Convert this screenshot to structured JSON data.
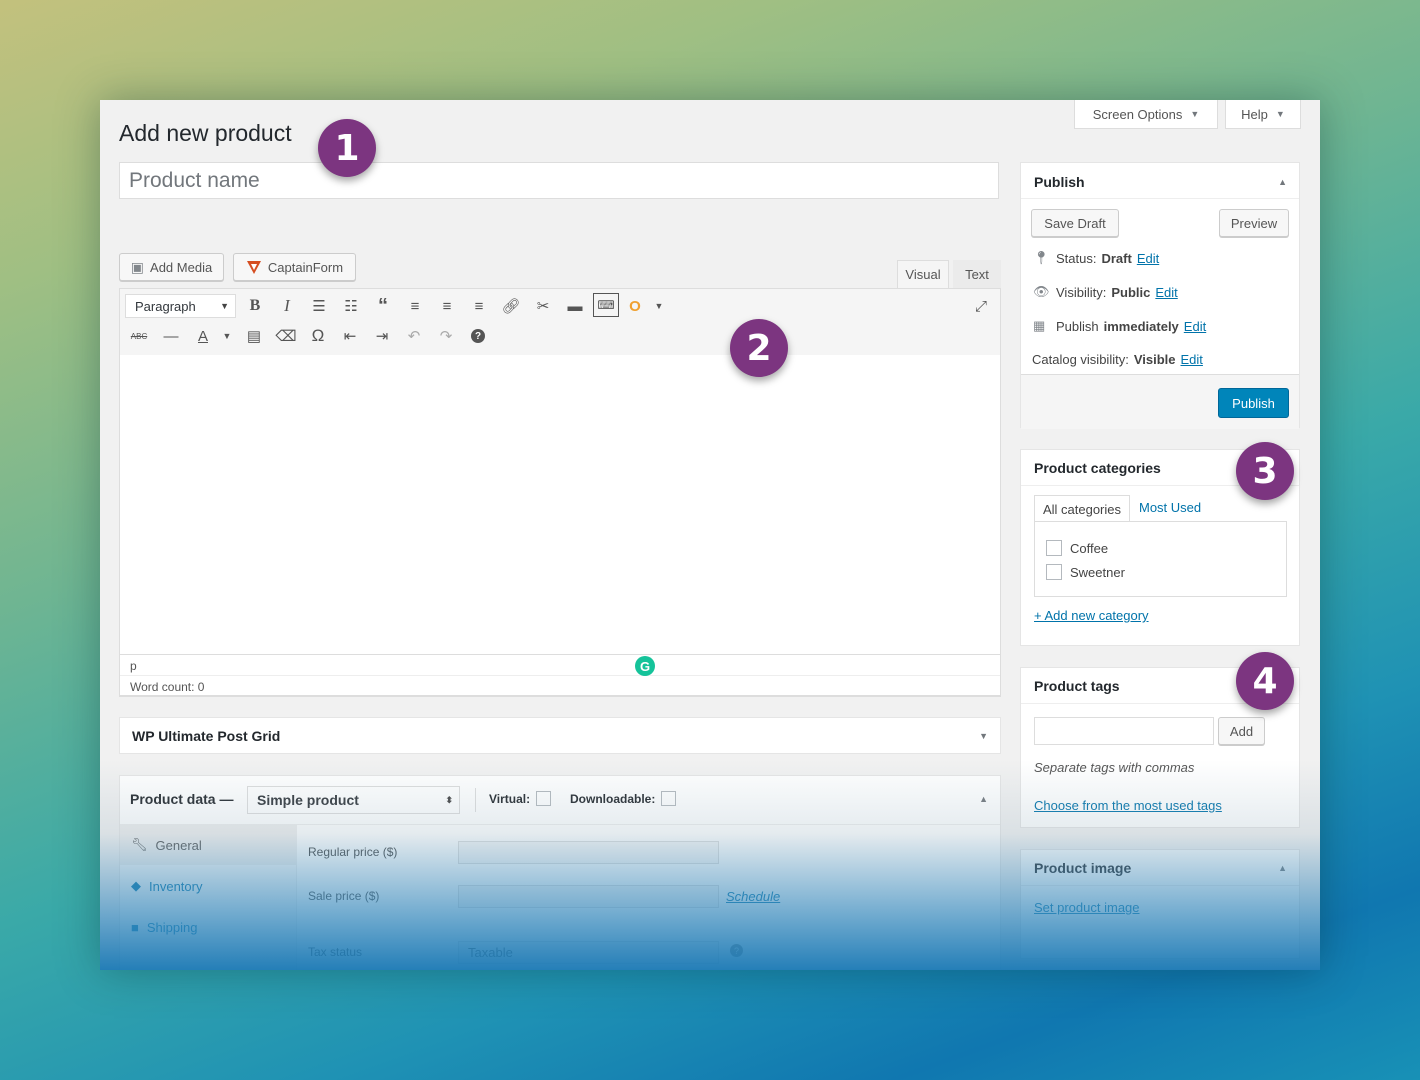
{
  "header": {
    "page_title": "Add new product",
    "screen_options_label": "Screen Options",
    "help_label": "Help",
    "product_name_placeholder": "Product name"
  },
  "editor": {
    "add_media_label": "Add Media",
    "captainform_label": "CaptainForm",
    "tab_visual": "Visual",
    "tab_text": "Text",
    "format_select": "Paragraph",
    "path_label": "p",
    "word_count": "Word count: 0"
  },
  "post_grid": {
    "title": "WP Ultimate Post Grid"
  },
  "product_data": {
    "title": "Product data —",
    "type_select": "Simple product",
    "virtual_label": "Virtual:",
    "downloadable_label": "Downloadable:",
    "tabs": [
      {
        "label": "General"
      },
      {
        "label": "Inventory"
      },
      {
        "label": "Shipping"
      }
    ],
    "regular_price_label": "Regular price ($)",
    "sale_price_label": "Sale price ($)",
    "schedule_link": "Schedule",
    "tax_status_label": "Tax status",
    "tax_status_value": "Taxable"
  },
  "publish": {
    "title": "Publish",
    "save_draft_label": "Save Draft",
    "preview_label": "Preview",
    "status_label": "Status:",
    "status_value": "Draft",
    "visibility_label": "Visibility:",
    "visibility_value": "Public",
    "publish_label": "Publish",
    "publish_value": "immediately",
    "catalog_label": "Catalog visibility:",
    "catalog_value": "Visible",
    "edit_link": "Edit",
    "publish_button": "Publish"
  },
  "categories": {
    "title": "Product categories",
    "tab_all": "All categories",
    "tab_most_used": "Most Used",
    "items": [
      {
        "label": "Coffee"
      },
      {
        "label": "Sweetner"
      }
    ],
    "add_new_link": "+ Add new category"
  },
  "tags": {
    "title": "Product tags",
    "add_button": "Add",
    "hint": "Separate tags with commas",
    "choose_link": "Choose from the most used tags"
  },
  "product_image": {
    "title": "Product image",
    "set_link": "Set product image"
  },
  "callouts": [
    "1",
    "2",
    "3",
    "4"
  ],
  "colors": {
    "callout": "#7c3580",
    "primary_button": "#0085ba",
    "link": "#0073aa"
  }
}
